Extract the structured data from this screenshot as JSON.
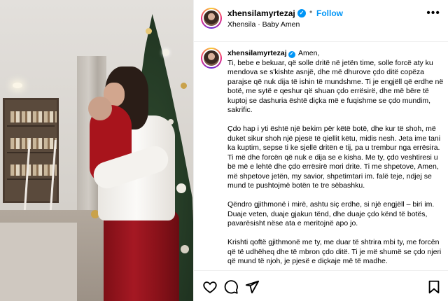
{
  "post": {
    "author": {
      "username": "xhensilamyrtezaj",
      "verified_mark": "✓",
      "separator": "•",
      "follow_label": "Follow",
      "subline": "Xhensila · Baby Amen"
    },
    "more_icon_label": "•••",
    "caption": {
      "username": "xhensilamyrtezaj",
      "verified_mark": "✓",
      "opening": "Amen,",
      "paragraphs": [
        "Ti, bebe e bekuar, që solle dritë në jetën time, solle forcë aty ku mendova se s'kishte asnjë, dhe më dhurove çdo ditë copëza parajse që nuk dija të ishin të mundshme. Ti je engjëll që erdhe në botë, me sytë e qeshur që shuan çdo errësirë, dhe më bëre të kuptoj se dashuria është diçka më e fuqishme se çdo mundim, sakrific.",
        "Çdo hap i yti është një bekim për këtë botë, dhe kur të shoh, më duket sikur shoh një pjesë të qiellit këtu, midis nesh. Jeta ime tani ka kuptim, sepse ti ke sjellë dritën e tij, pa u trembur nga errësira. Ti më dhe forcën që nuk e dija se e kisha. Me ty, çdo veshtiresi u bë më e lehtë dhe çdo errësirë mori drite. Ti me shpetove, Amen, më shpetove jetën, my savior, shpetimtari im. falë teje, ndjej se mund te pushtojmë botën te tre sëbashku.",
        "Qëndro gjithmonë i mirë, ashtu siç erdhe, si një engjëll – biri im. Duaje veten, duaje gjakun tënd, dhe duaje çdo kënd të botës, pavarësisht nëse ata e meritojnë apo jo.",
        "Krishti qoftë gjithmonë me ty, me duar të shtrira mbi ty, me forcën që të udhëheq dhe të mbron çdo ditë. Ti je më shumë se çdo njeri që mund të njoh, je pjesë e diçkaje më të madhe."
      ]
    },
    "actions": [
      "heart-icon",
      "comment-icon",
      "share-icon",
      "bookmark-icon"
    ]
  }
}
